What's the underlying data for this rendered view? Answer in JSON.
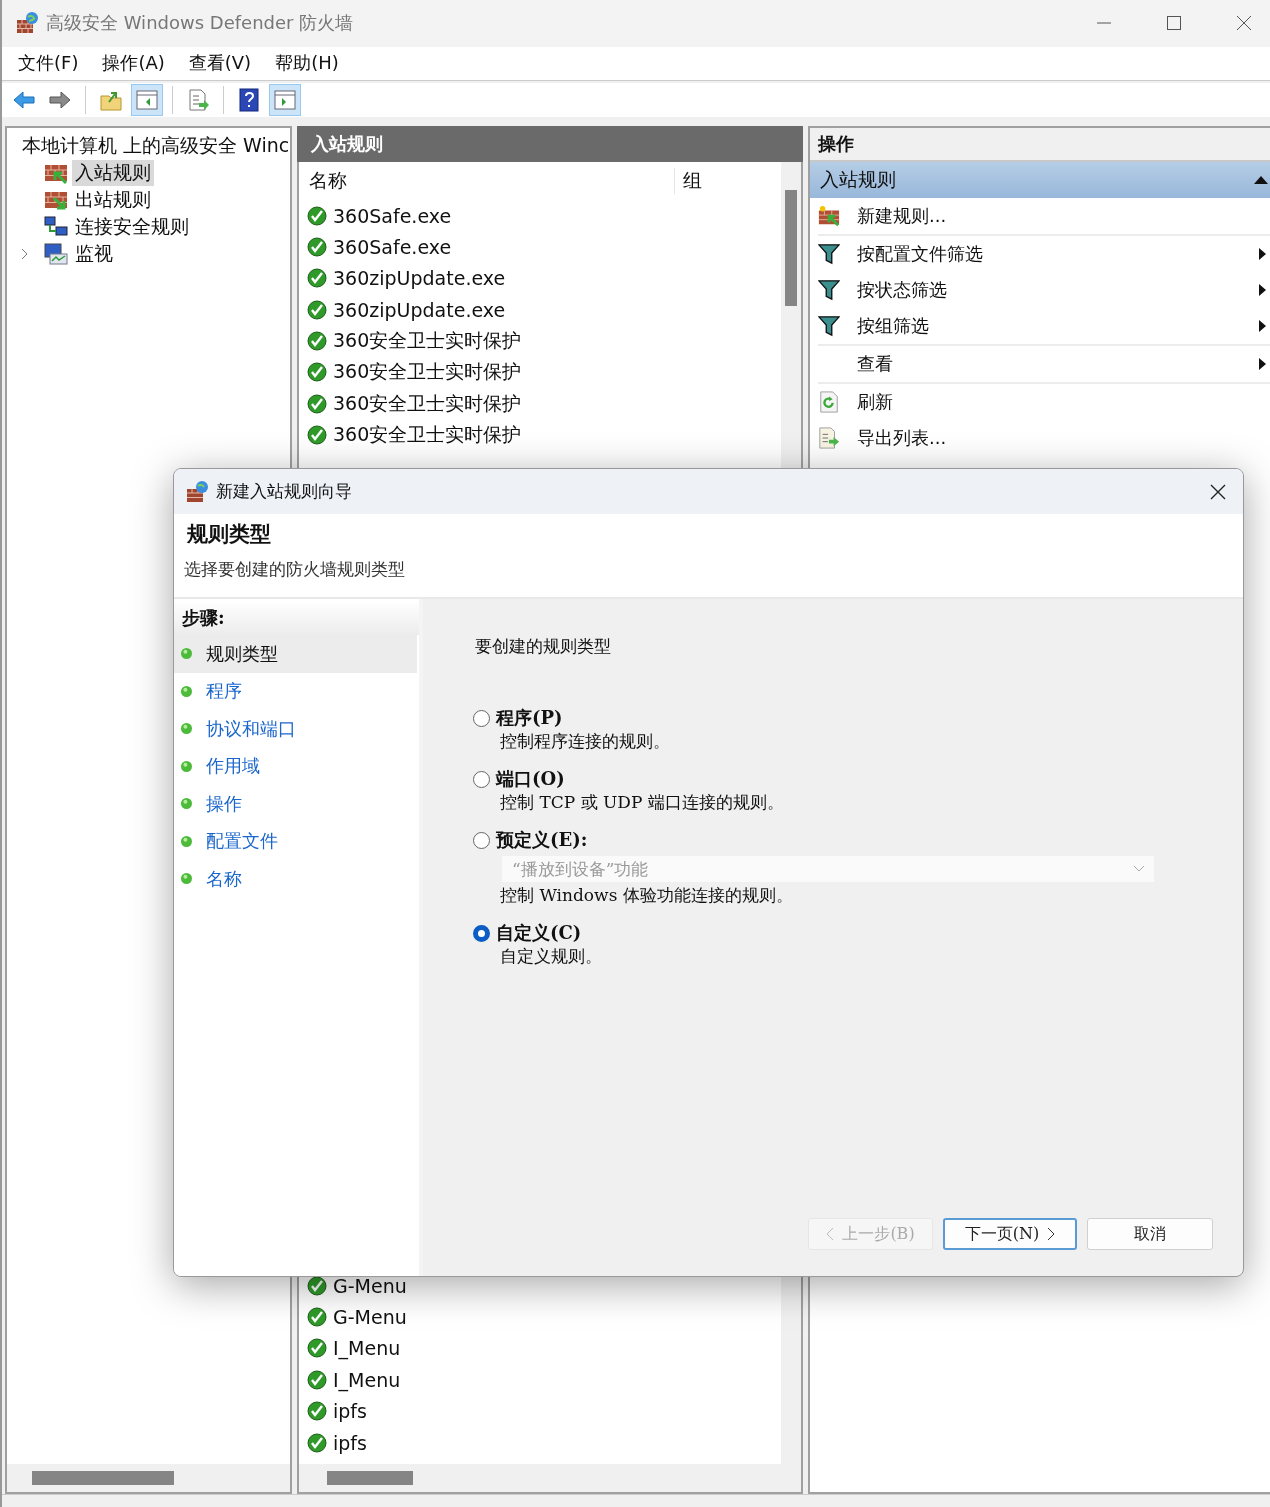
{
  "window": {
    "title": "高级安全 Windows Defender 防火墙"
  },
  "menu": [
    "文件(F)",
    "操作(A)",
    "查看(V)",
    "帮助(H)"
  ],
  "toolbar": [
    {
      "kind": "back",
      "pressed": false
    },
    {
      "kind": "forward",
      "pressed": false
    },
    {
      "kind": "up",
      "pressed": false
    },
    {
      "kind": "tree",
      "pressed": true
    },
    {
      "kind": "export",
      "pressed": false
    },
    {
      "kind": "help",
      "pressed": false
    },
    {
      "kind": "actions",
      "pressed": true
    }
  ],
  "tree": {
    "label": "本地计算机 上的高级安全 Winc",
    "children": [
      {
        "label": "入站规则",
        "kind": "inbound",
        "selected": true,
        "has_children": false
      },
      {
        "label": "出站规则",
        "kind": "outbound",
        "selected": false,
        "has_children": false
      },
      {
        "label": "连接安全规则",
        "kind": "connection",
        "selected": false,
        "has_children": false
      },
      {
        "label": "监视",
        "kind": "monitor",
        "selected": false,
        "has_children": true
      }
    ]
  },
  "rules": {
    "title": "入站规则",
    "columns": [
      "名称",
      "组"
    ],
    "rows_top": [
      {
        "name": "360Safe.exe",
        "enabled": true
      },
      {
        "name": "360Safe.exe",
        "enabled": true
      },
      {
        "name": "360zipUpdate.exe",
        "enabled": true
      },
      {
        "name": "360zipUpdate.exe",
        "enabled": true
      },
      {
        "name": "360安全卫士实时保护",
        "enabled": true
      },
      {
        "name": "360安全卫士实时保护",
        "enabled": true
      },
      {
        "name": "360安全卫士实时保护",
        "enabled": true
      },
      {
        "name": "360安全卫士实时保护",
        "enabled": true
      }
    ],
    "rows_bottom": [
      {
        "name": "G-Menu",
        "enabled": true
      },
      {
        "name": "G-Menu",
        "enabled": true
      },
      {
        "name": "I_Menu",
        "enabled": true
      },
      {
        "name": "I_Menu",
        "enabled": true
      },
      {
        "name": "ipfs",
        "enabled": true
      },
      {
        "name": "ipfs",
        "enabled": true
      }
    ]
  },
  "actions": {
    "title": "操作",
    "section": {
      "title": "入站规则",
      "expanded": true
    },
    "items": [
      {
        "label": "新建规则...",
        "kind": "new",
        "submenu": false,
        "separator_before": false
      },
      {
        "label": "按配置文件筛选",
        "kind": "filter",
        "submenu": true,
        "separator_before": true
      },
      {
        "label": "按状态筛选",
        "kind": "filter",
        "submenu": true,
        "separator_before": false
      },
      {
        "label": "按组筛选",
        "kind": "filter",
        "submenu": true,
        "separator_before": false
      },
      {
        "label": "查看",
        "kind": "view",
        "submenu": true,
        "separator_before": true
      },
      {
        "label": "刷新",
        "kind": "refresh",
        "submenu": false,
        "separator_before": true
      },
      {
        "label": "导出列表...",
        "kind": "export",
        "submenu": false,
        "separator_before": false
      }
    ]
  },
  "dialog": {
    "title": "新建入站规则向导",
    "heading": "规则类型",
    "subheading": "选择要创建的防火墙规则类型",
    "steps_title": "步骤:",
    "steps": [
      {
        "label": "规则类型",
        "selected": true
      },
      {
        "label": "程序",
        "selected": false
      },
      {
        "label": "协议和端口",
        "selected": false
      },
      {
        "label": "作用域",
        "selected": false
      },
      {
        "label": "操作",
        "selected": false
      },
      {
        "label": "配置文件",
        "selected": false
      },
      {
        "label": "名称",
        "selected": false
      }
    ],
    "prompt": "要创建的规则类型",
    "options": [
      {
        "label": "程序(P)",
        "description": "控制程序连接的规则。",
        "selected": false,
        "kind": "plain"
      },
      {
        "label": "端口(O)",
        "description": "控制 TCP 或 UDP 端口连接的规则。",
        "selected": false,
        "kind": "plain"
      },
      {
        "label": "预定义(E):",
        "description": "控制 Windows 体验功能连接的规则。",
        "selected": false,
        "kind": "dropdown",
        "dropdown": {
          "value": "“播放到设备”功能",
          "disabled": true
        }
      },
      {
        "label": "自定义(C)",
        "description": "自定义规则。",
        "selected": true,
        "kind": "plain"
      }
    ],
    "buttons": [
      {
        "label": "上一步(B)",
        "kind": "back",
        "disabled": true,
        "default": false
      },
      {
        "label": "下一页(N)",
        "kind": "next",
        "disabled": false,
        "default": true
      },
      {
        "label": "取消",
        "kind": "cancel",
        "disabled": false,
        "default": false
      }
    ]
  }
}
